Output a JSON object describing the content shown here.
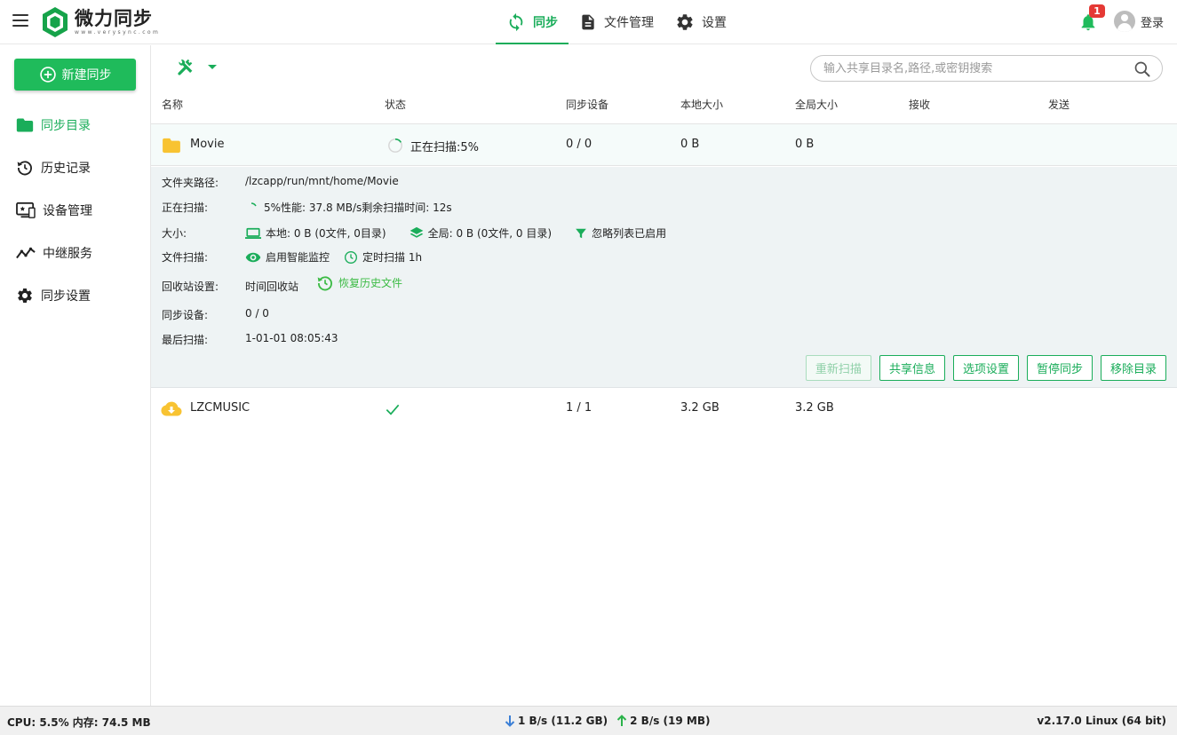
{
  "app": {
    "name": "微力同步",
    "url_text": "www.verysync.com"
  },
  "nav": {
    "items": [
      {
        "label": "同步",
        "icon": "sync-icon"
      },
      {
        "label": "文件管理",
        "icon": "file-icon"
      },
      {
        "label": "设置",
        "icon": "gear-icon"
      }
    ],
    "active": "同步"
  },
  "notifications": {
    "count": "1"
  },
  "user": {
    "login_label": "登录"
  },
  "sidebar": {
    "new_button": "新建同步",
    "items": [
      {
        "label": "同步目录",
        "icon": "folder-icon"
      },
      {
        "label": "历史记录",
        "icon": "history-icon"
      },
      {
        "label": "设备管理",
        "icon": "monitor-icon"
      },
      {
        "label": "中继服务",
        "icon": "relay-icon"
      },
      {
        "label": "同步设置",
        "icon": "gear-icon"
      }
    ]
  },
  "search": {
    "placeholder": "输入共享目录名,路径,或密钥搜索"
  },
  "table": {
    "headers": [
      "名称",
      "状态",
      "同步设备",
      "本地大小",
      "全局大小",
      "接收",
      "发送"
    ],
    "rows": [
      {
        "name": "Movie",
        "status": "正在扫描:5%",
        "devices": "0 / 0",
        "local": "0 B",
        "global": "0 B",
        "icon": "folder-icon"
      },
      {
        "name": "LZCMUSIC",
        "status": "",
        "devices": "1 / 1",
        "local": "3.2 GB",
        "global": "3.2 GB",
        "icon": "cloud-download-icon",
        "status_icon": "check-icon"
      }
    ]
  },
  "detail": {
    "path_label": "文件夹路径:",
    "path_value": "/lzcapp/run/mnt/home/Movie",
    "scanning_label": "正在扫描:",
    "scanning_value": "5%性能: 37.8 MB/s剩余扫描时间: 12s",
    "size_label": "大小:",
    "size_local": "本地: 0 B (0文件, 0目录)",
    "size_global": "全局: 0 B (0文件, 0 目录)",
    "ignore_label": "忽略列表已启用",
    "scan_label": "文件扫描:",
    "smart_monitor": "启用智能监控",
    "timed_scan": "定时扫描 1h",
    "recycle_label": "回收站设置:",
    "recycle_value": "时间回收站",
    "restore_history": "恢复历史文件",
    "devices_label": "同步设备:",
    "devices_value": "0 / 0",
    "last_scan_label": "最后扫描:",
    "last_scan_value": "1-01-01 08:05:43",
    "actions": {
      "rescan": "重新扫描",
      "share_info": "共享信息",
      "options": "选项设置",
      "pause": "暂停同步",
      "remove": "移除目录"
    }
  },
  "status": {
    "cpu_mem": "CPU: 5.5%  内存: 74.5 MB",
    "down": "1 B/s (11.2 GB)",
    "up": "2 B/s (19 MB)",
    "version": "v2.17.0  Linux (64 bit)"
  },
  "colors": {
    "accent": "#1aad5a",
    "folder": "#f8c332",
    "badge": "#e53935"
  }
}
